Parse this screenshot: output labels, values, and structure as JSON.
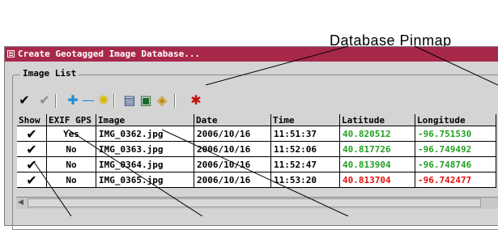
{
  "callout": {
    "label": "Database Pinmap"
  },
  "window": {
    "title": "Create Geotagged Image Database..."
  },
  "group": {
    "label": "Image List"
  },
  "toolbar": {
    "buttons": [
      {
        "icon": "check-icon",
        "glyph": "✔",
        "color": "#000000"
      },
      {
        "icon": "check-gray-icon",
        "glyph": "✔",
        "color": "#8a8a8a"
      },
      {
        "icon": "plus-icon",
        "glyph": "✚",
        "color": "#1a8fd0"
      },
      {
        "icon": "minus-icon",
        "glyph": "—",
        "color": "#1a8fd0"
      },
      {
        "icon": "sun-icon",
        "glyph": "✺",
        "color": "#d8b800"
      },
      {
        "icon": "table-icon",
        "glyph": "▤",
        "color": "#2a4a8a"
      },
      {
        "icon": "image-icon",
        "glyph": "▣",
        "color": "#1a6a2a"
      },
      {
        "icon": "tag-icon",
        "glyph": "◈",
        "color": "#c08a00"
      },
      {
        "icon": "pinmap-icon",
        "glyph": "✱",
        "color": "#c01010"
      }
    ]
  },
  "table": {
    "columns": [
      "Show",
      "EXIF GPS",
      "Image",
      "Date",
      "Time",
      "Latitude",
      "Longitude"
    ],
    "rows": [
      {
        "show": "✔",
        "exif": "Yes",
        "image": "IMG_0362.jpg",
        "date": "2006/10/16",
        "time": "11:51:37",
        "lat": "40.820512",
        "lon": "-96.751530",
        "status": "green"
      },
      {
        "show": "✔",
        "exif": "No",
        "image": "IMG_0363.jpg",
        "date": "2006/10/16",
        "time": "11:52:06",
        "lat": "40.817726",
        "lon": "-96.749492",
        "status": "green"
      },
      {
        "show": "✔",
        "exif": "No",
        "image": "IMG_0364.jpg",
        "date": "2006/10/16",
        "time": "11:52:47",
        "lat": "40.813904",
        "lon": "-96.748746",
        "status": "green"
      },
      {
        "show": "✔",
        "exif": "No",
        "image": "IMG_0365.jpg",
        "date": "2006/10/16",
        "time": "11:53:20",
        "lat": "40.813704",
        "lon": "-96.742477",
        "status": "red"
      }
    ]
  },
  "colors": {
    "titlebar": "#a8284a",
    "green": "#22a022",
    "red": "#e01010"
  }
}
